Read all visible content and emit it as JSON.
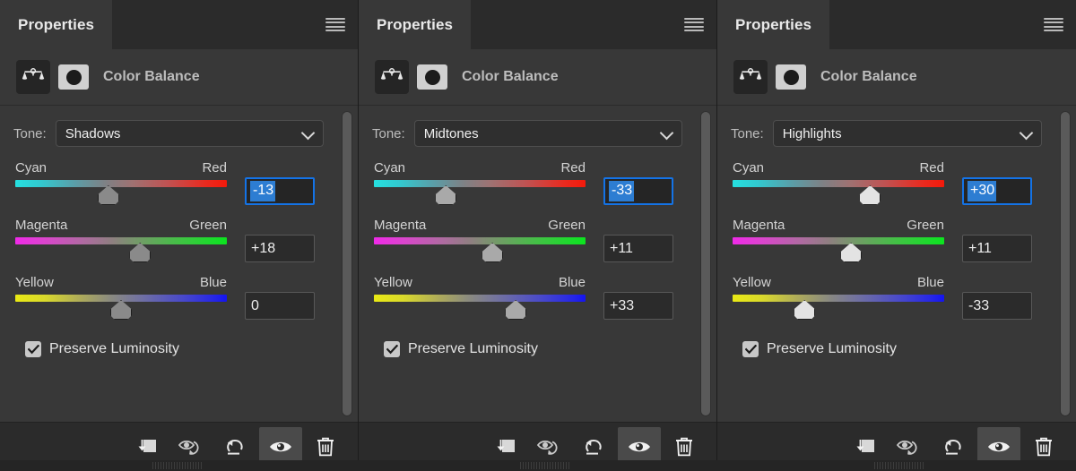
{
  "panels": [
    {
      "tab_label": "Properties",
      "menu_icon": "hamburger-icon",
      "adjustment_icon": "color-balance-scales-icon",
      "mask_icon": "layer-mask-thumbnail-icon",
      "adjustment_title": "Color Balance",
      "tone_label": "Tone:",
      "tone_value": "Shadows",
      "tone_options": [
        "Shadows",
        "Midtones",
        "Highlights"
      ],
      "sliders": [
        {
          "left_label": "Cyan",
          "right_label": "Red",
          "value": "-13",
          "position": 44,
          "focused": true
        },
        {
          "left_label": "Magenta",
          "right_label": "Green",
          "value": "+18",
          "position": 59,
          "focused": false
        },
        {
          "left_label": "Yellow",
          "right_label": "Blue",
          "value": "0",
          "position": 50,
          "focused": false
        }
      ],
      "preserve_luminosity_label": "Preserve Luminosity",
      "preserve_luminosity_checked": true,
      "toolbar": [
        {
          "name": "clip-to-layer-icon",
          "active": false
        },
        {
          "name": "view-previous-state-icon",
          "active": false
        },
        {
          "name": "reset-adjustment-icon",
          "active": false
        },
        {
          "name": "toggle-visibility-eye-icon",
          "active": true
        },
        {
          "name": "delete-layer-trash-icon",
          "active": false
        }
      ]
    },
    {
      "tab_label": "Properties",
      "menu_icon": "hamburger-icon",
      "adjustment_icon": "color-balance-scales-icon",
      "mask_icon": "layer-mask-thumbnail-icon",
      "adjustment_title": "Color Balance",
      "tone_label": "Tone:",
      "tone_value": "Midtones",
      "tone_options": [
        "Shadows",
        "Midtones",
        "Highlights"
      ],
      "sliders": [
        {
          "left_label": "Cyan",
          "right_label": "Red",
          "value": "-33",
          "position": 34,
          "focused": true
        },
        {
          "left_label": "Magenta",
          "right_label": "Green",
          "value": "+11",
          "position": 56,
          "focused": false
        },
        {
          "left_label": "Yellow",
          "right_label": "Blue",
          "value": "+33",
          "position": 67,
          "focused": false
        }
      ],
      "preserve_luminosity_label": "Preserve Luminosity",
      "preserve_luminosity_checked": true,
      "toolbar": [
        {
          "name": "clip-to-layer-icon",
          "active": false
        },
        {
          "name": "view-previous-state-icon",
          "active": false
        },
        {
          "name": "reset-adjustment-icon",
          "active": false
        },
        {
          "name": "toggle-visibility-eye-icon",
          "active": true
        },
        {
          "name": "delete-layer-trash-icon",
          "active": false
        }
      ]
    },
    {
      "tab_label": "Properties",
      "menu_icon": "hamburger-icon",
      "adjustment_icon": "color-balance-scales-icon",
      "mask_icon": "layer-mask-thumbnail-icon",
      "adjustment_title": "Color Balance",
      "tone_label": "Tone:",
      "tone_value": "Highlights",
      "tone_options": [
        "Shadows",
        "Midtones",
        "Highlights"
      ],
      "sliders": [
        {
          "left_label": "Cyan",
          "right_label": "Red",
          "value": "+30",
          "position": 65,
          "focused": true
        },
        {
          "left_label": "Magenta",
          "right_label": "Green",
          "value": "+11",
          "position": 56,
          "focused": false
        },
        {
          "left_label": "Yellow",
          "right_label": "Blue",
          "value": "-33",
          "position": 34,
          "focused": false
        }
      ],
      "preserve_luminosity_label": "Preserve Luminosity",
      "preserve_luminosity_checked": true,
      "toolbar": [
        {
          "name": "clip-to-layer-icon",
          "active": false
        },
        {
          "name": "view-previous-state-icon",
          "active": false
        },
        {
          "name": "reset-adjustment-icon",
          "active": false
        },
        {
          "name": "toggle-visibility-eye-icon",
          "active": true
        },
        {
          "name": "delete-layer-trash-icon",
          "active": false
        }
      ]
    }
  ],
  "colors": {
    "panel_bg": "#383838",
    "chrome_bg": "#2b2b2b",
    "focus_blue": "#1473e6",
    "selection_blue": "#2d7dd2",
    "text": "#e4e4e4"
  }
}
